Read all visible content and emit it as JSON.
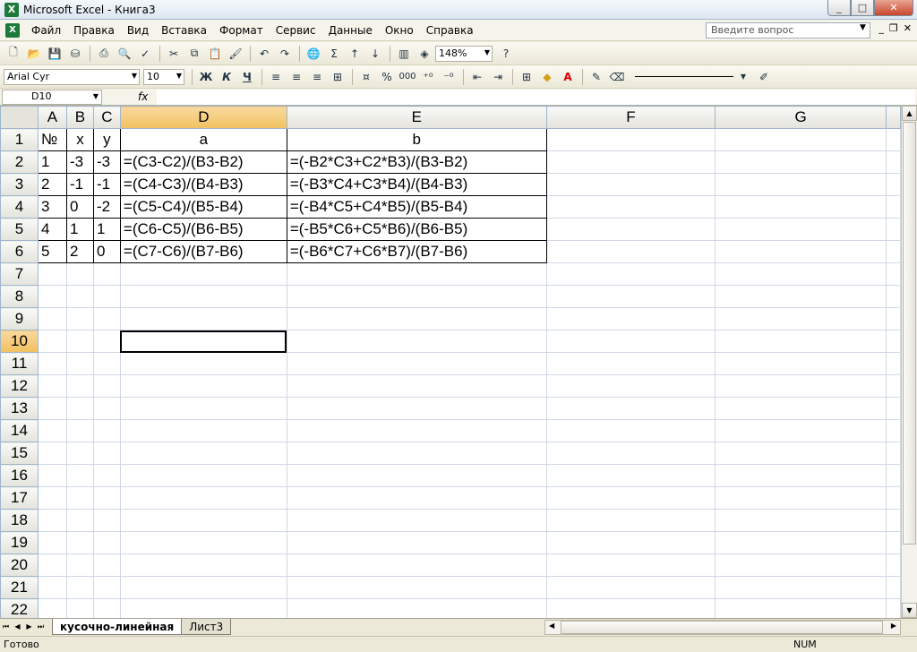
{
  "window": {
    "title": "Microsoft Excel - Книга3",
    "minimize": "_",
    "maximize": "□",
    "close": "✕"
  },
  "menu": {
    "items": [
      "Файл",
      "Правка",
      "Вид",
      "Вставка",
      "Формат",
      "Сервис",
      "Данные",
      "Окно",
      "Справка"
    ],
    "help_placeholder": "Введите вопрос"
  },
  "toolbar": {
    "zoom": "148%",
    "font_name": "Arial Cyr",
    "font_size": "10",
    "bold": "Ж",
    "italic": "К",
    "underline": "Ч",
    "percent": "%",
    "thousands": "000",
    "sigma": "Σ"
  },
  "formula_bar": {
    "name_box": "D10",
    "fx": "fx",
    "content": ""
  },
  "sheet": {
    "columns": [
      "A",
      "B",
      "C",
      "D",
      "E",
      "F",
      "G"
    ],
    "rows": [
      [
        "№",
        "x",
        "y",
        "a",
        "b"
      ],
      [
        "1",
        "-3",
        "-3",
        "=(C3-C2)/(B3-B2)",
        "=(-B2*C3+C2*B3)/(B3-B2)"
      ],
      [
        "2",
        "-1",
        "-1",
        "=(C4-C3)/(B4-B3)",
        "=(-B3*C4+C3*B4)/(B4-B3)"
      ],
      [
        "3",
        "0",
        "-2",
        "=(C5-C4)/(B5-B4)",
        "=(-B4*C5+C4*B5)/(B5-B4)"
      ],
      [
        "4",
        "1",
        "1",
        "=(C6-C5)/(B6-B5)",
        "=(-B5*C6+C5*B6)/(B6-B5)"
      ],
      [
        "5",
        "2",
        "0",
        "=(C7-C6)/(B7-B6)",
        "=(-B6*C7+C6*B7)/(B7-B6)"
      ]
    ],
    "row_numbers": [
      "1",
      "2",
      "3",
      "4",
      "5",
      "6",
      "7",
      "8",
      "9",
      "10",
      "11",
      "12",
      "13",
      "14",
      "15",
      "16",
      "17",
      "18",
      "19",
      "20",
      "21",
      "22"
    ],
    "selected_cell": "D10"
  },
  "tabs": {
    "active": "кусочно-линейная",
    "other": "Лист3"
  },
  "status": {
    "ready": "Готово",
    "num": "NUM"
  }
}
